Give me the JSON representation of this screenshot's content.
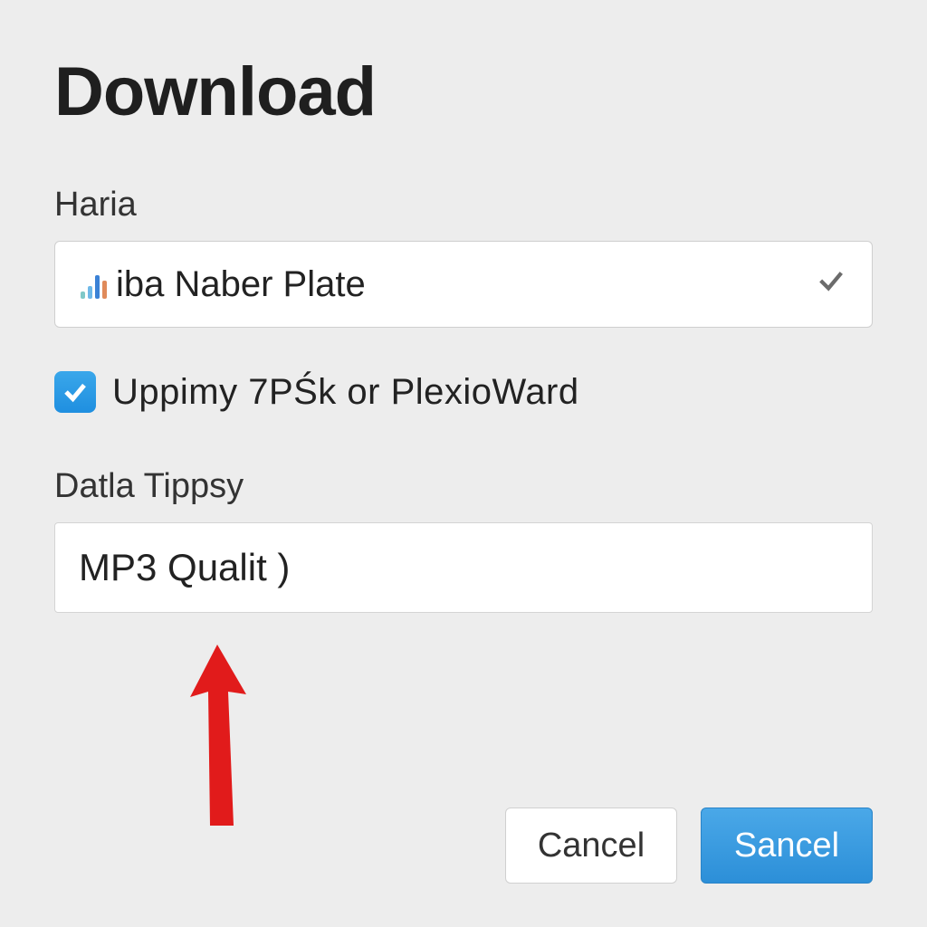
{
  "dialog": {
    "title": "Download",
    "field1_label": "Haria",
    "select_value": "iba Naber Plate",
    "checkbox_checked": true,
    "checkbox_label": "Uppimy 7PŚk or PlexioWard",
    "field2_label": "Datla Tippsy",
    "input_value": "MP3 Qualit )",
    "cancel_label": "Cancel",
    "confirm_label": "Sancel"
  },
  "colors": {
    "accent": "#2c8fd8",
    "background": "#ededed",
    "arrow": "#e11b1b"
  }
}
